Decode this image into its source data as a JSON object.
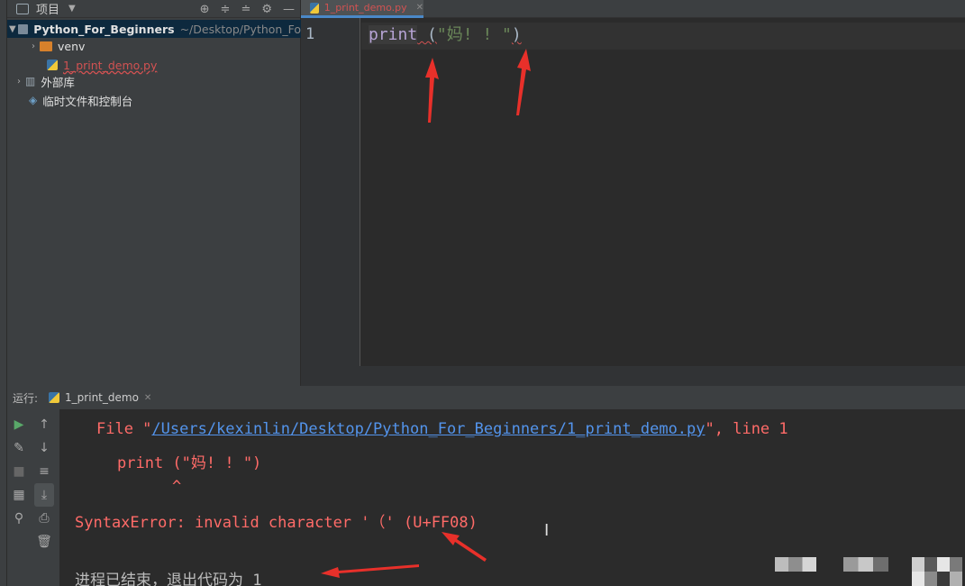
{
  "project_panel": {
    "title": "项目",
    "tree": {
      "root_name": "Python_For_Beginners",
      "root_path": "~/Desktop/Python_Fo",
      "items": [
        {
          "label": "venv"
        },
        {
          "label": "1_print_demo.py"
        }
      ],
      "external_libraries": "外部库",
      "scratches": "临时文件和控制台"
    }
  },
  "editor": {
    "tab_label": "1_print_demo.py",
    "line_number": "1",
    "code": {
      "keyword": "print",
      "open_paren": " (",
      "string": "\"妈! ! \"",
      "close_paren": ")"
    }
  },
  "run_panel": {
    "label": "运行:",
    "tab_label": "1_print_demo",
    "console": {
      "file_prefix": "File \"",
      "file_path": "/Users/kexinlin/Desktop/Python_For_Beginners/1_print_demo.py",
      "file_suffix": "\", line 1",
      "code_echo": "print (\"妈! ! \")",
      "caret": "^",
      "error": "SyntaxError: invalid character '（' (U+FF08)",
      "exit_message": "进程已结束，退出代码为 1"
    }
  },
  "annotation_color": "#e8302a"
}
